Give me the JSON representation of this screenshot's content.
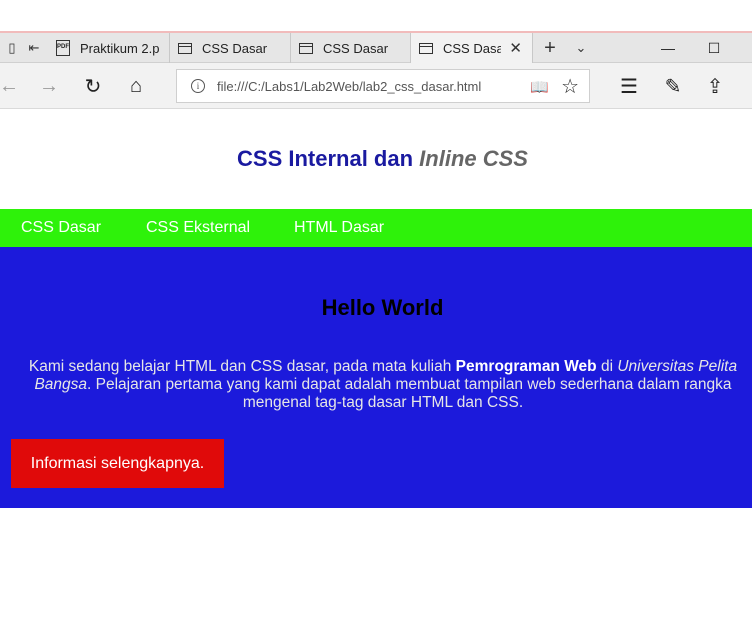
{
  "browser": {
    "tabs": [
      {
        "label": "Praktikum 2.p",
        "icon": "pdf-icon"
      },
      {
        "label": "CSS Dasar",
        "icon": "page-icon"
      },
      {
        "label": "CSS Dasar",
        "icon": "page-icon"
      },
      {
        "label": "CSS Dasar",
        "icon": "page-icon",
        "active": true
      }
    ],
    "address": "file:///C:/Labs1/Lab2Web/lab2_css_dasar.html"
  },
  "page": {
    "title_main": "CSS Internal dan ",
    "title_italic": "Inline CSS",
    "nav": [
      "CSS Dasar",
      "CSS Eksternal",
      "HTML Dasar"
    ],
    "hero": {
      "heading": "Hello World",
      "text_1": "Kami sedang belajar HTML dan CSS dasar, pada mata kuliah ",
      "text_bold": "Pemrograman Web",
      "text_2": " di ",
      "text_italic": "Universitas Pelita Bangsa",
      "text_3": ". Pelajaran pertama yang kami dapat adalah membuat tampilan web sederhana dalam rangka mengenal tag-tag dasar HTML dan CSS.",
      "button": "Informasi selengkapnya."
    }
  },
  "colors": {
    "title": "#1a1aa0",
    "nav_bg": "#2ef20a",
    "hero_bg": "#1c1adb",
    "button_bg": "#e00a0a"
  }
}
